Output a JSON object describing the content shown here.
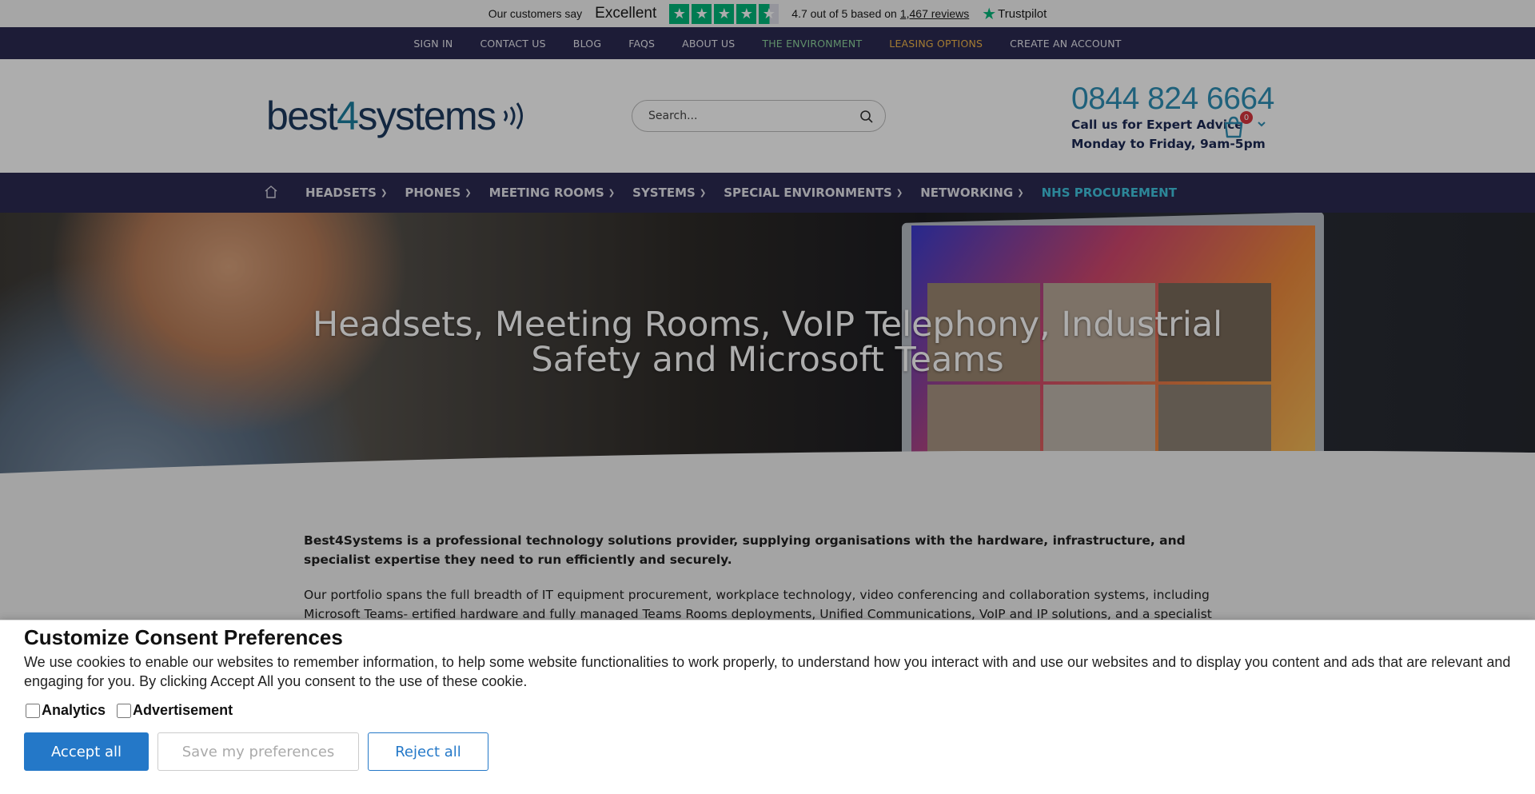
{
  "trustpilot": {
    "customers_say": "Our customers say",
    "rating_word": "Excellent",
    "score_text": "4.7 out of 5 based on",
    "reviews_link": "1,467 reviews",
    "brand": "Trustpilot",
    "stars": 4.7
  },
  "utility_nav": [
    {
      "label": "SIGN IN"
    },
    {
      "label": "CONTACT US"
    },
    {
      "label": "BLOG"
    },
    {
      "label": "FAQS"
    },
    {
      "label": "ABOUT US"
    },
    {
      "label": "THE ENVIRONMENT"
    },
    {
      "label": "LEASING OPTIONS"
    },
    {
      "label": "CREATE AN ACCOUNT"
    }
  ],
  "header": {
    "logo_part1": "best",
    "logo_part2": "4",
    "logo_part3": "systems",
    "search_placeholder": "Search...",
    "phone": "0844 824 6664",
    "call_text": "Call us for Expert Advice",
    "hours": "Monday to Friday, 9am-5pm",
    "cart_count": "0"
  },
  "main_nav": [
    {
      "label": "HEADSETS"
    },
    {
      "label": "PHONES"
    },
    {
      "label": "MEETING ROOMS"
    },
    {
      "label": "SYSTEMS"
    },
    {
      "label": "SPECIAL ENVIRONMENTS"
    },
    {
      "label": "NETWORKING"
    },
    {
      "label": "NHS PROCUREMENT"
    }
  ],
  "hero": {
    "title_line1": "Headsets, Meeting Rooms, VoIP Telephony, Industrial",
    "title_line2": "Safety and Microsoft Teams"
  },
  "content": {
    "lead": "Best4Systems is a professional technology solutions provider, supplying organisations with the hardware, infrastructure, and specialist expertise they need to run efficiently and securely.",
    "body": "Our portfolio spans the full breadth of IT equipment procurement, workplace technology, video conferencing and collaboration systems, including Microsoft Teams- ertified hardware and fully managed Teams Rooms deployments, Unified Communications, VoIP and IP solutions, and a specialist range"
  },
  "cookie": {
    "title": "Customize Consent Preferences",
    "close_glyph": "",
    "description": "We use cookies to enable our websites to remember information, to help some website functionalities to work properly, to understand how you interact with and use our websites and to display you content and ads that are relevant and engaging for you. By clicking Accept All you consent to the use of these cookie.",
    "checkbox_analytics": "Analytics",
    "checkbox_advertisement": "Advertisement",
    "accept_label": "Accept all",
    "save_label": "Save my preferences",
    "reject_label": "Reject all"
  },
  "colors": {
    "nav_bg": "#2c2a52",
    "accent_blue": "#2478c8",
    "trustpilot_green": "#00b67a",
    "environment_green": "#8ed39c",
    "leasing_orange": "#f0b54a",
    "nhs_cyan": "#42c6e0"
  }
}
